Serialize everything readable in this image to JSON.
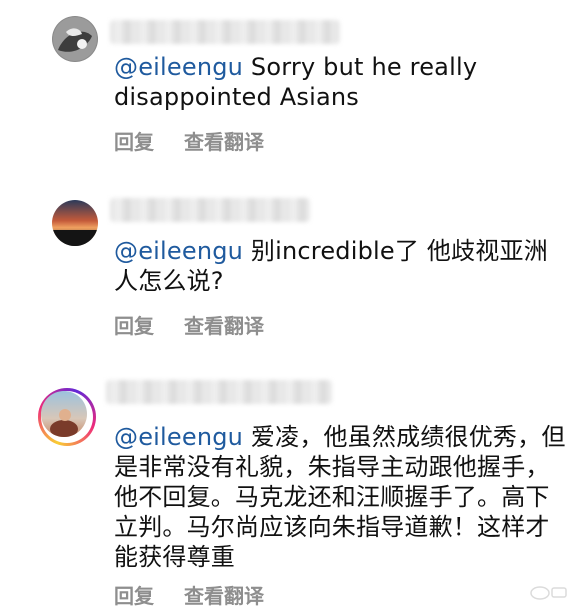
{
  "comments": [
    {
      "mention": "@eileengu",
      "text": " Sorry but he really disappointed Asians",
      "reply": "回复",
      "translate": "查看翻译"
    },
    {
      "mention": "@eileengu",
      "text": " 别incredible了 他歧视亚洲人怎么说?",
      "reply": "回复",
      "translate": "查看翻译"
    },
    {
      "mention": "@eileengu",
      "text": " 爱凌，他虽然成绩很优秀，但是非常没有礼貌，朱指导主动跟他握手，他不回复。马克龙还和汪顺握手了。高下立判。马尔尚应该向朱指导道歉！这样才能获得尊重",
      "reply": "回复",
      "translate": "查看翻译"
    }
  ],
  "icons": {
    "avatar1": "avatar-icon",
    "avatar2": "avatar-icon",
    "avatar3": "avatar-story-ring-icon"
  },
  "colors": {
    "mention": "#1f5a9e",
    "action": "#8e8e8e",
    "text": "#111111"
  }
}
